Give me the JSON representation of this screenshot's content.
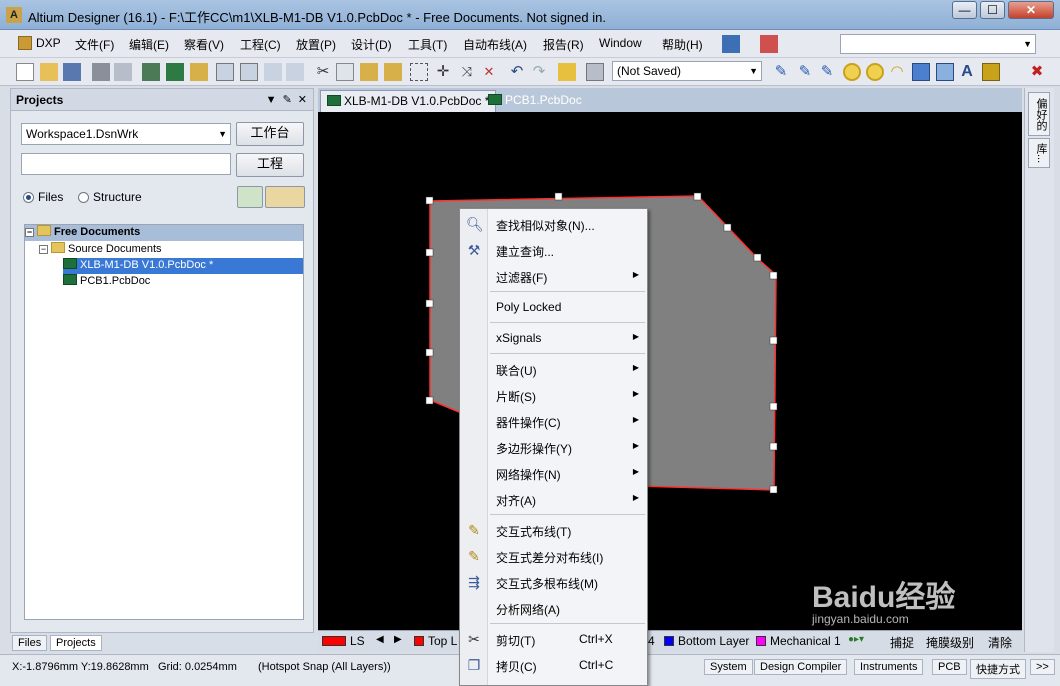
{
  "window": {
    "title": "Altium Designer (16.1) - F:\\工作CC\\m1\\XLB-M1-DB V1.0.PcbDoc * - Free Documents. Not signed in.",
    "minimize": "—",
    "maximize": "☐",
    "close": "✕"
  },
  "menubar": {
    "dxp": "DXP",
    "items": [
      "文件(F)",
      "编辑(E)",
      "察看(V)",
      "工程(C)",
      "放置(P)",
      "设计(D)",
      "工具(T)",
      "自动布线(A)",
      "报告(R)",
      "Window",
      "帮助(H)"
    ]
  },
  "toolbar": {
    "save_state": "(Not Saved)"
  },
  "projects_panel": {
    "title": "Projects",
    "workspace_select": "Workspace1.DsnWrk",
    "workspace_button": "工作台",
    "project_input": "",
    "project_button": "工程",
    "radio_files": "Files",
    "radio_structure": "Structure",
    "tree": {
      "root": "Free Documents",
      "folder": "Source Documents",
      "files": [
        "XLB-M1-DB V1.0.PcbDoc *",
        "PCB1.PcbDoc"
      ]
    },
    "tabs": [
      "Files",
      "Projects"
    ]
  },
  "doc_tabs": [
    "XLB-M1-DB V1.0.PcbDoc *",
    "PCB1.PcbDoc"
  ],
  "layer_bar": {
    "ls": "LS",
    "layers": [
      {
        "name": "Top L",
        "color": "#ff0000"
      },
      {
        "name": "4",
        "color": ""
      },
      {
        "name": "Bottom Layer",
        "color": "#0000ff"
      },
      {
        "name": "Mechanical 1",
        "color": "#ff00ff"
      }
    ],
    "actions": [
      "捕捉",
      "掩膜级别",
      "清除"
    ]
  },
  "right_strip": [
    "偏好的",
    "库..."
  ],
  "context_menu": {
    "items": [
      {
        "label": "查找相似对象(N)...",
        "icon": "search-icon"
      },
      {
        "label": "建立查询...",
        "icon": "hammer-icon"
      },
      {
        "label": "过滤器(F)",
        "submenu": true
      },
      {
        "label": "Poly Locked"
      },
      {
        "label": "xSignals",
        "submenu": true
      },
      {
        "label": "联合(U)",
        "submenu": true
      },
      {
        "label": "片断(S)",
        "submenu": true
      },
      {
        "label": "器件操作(C)",
        "submenu": true
      },
      {
        "label": "多边形操作(Y)",
        "submenu": true
      },
      {
        "label": "网络操作(N)",
        "submenu": true
      },
      {
        "label": "对齐(A)",
        "submenu": true
      },
      {
        "label": "交互式布线(T)",
        "icon": "route-icon"
      },
      {
        "label": "交互式差分对布线(I)",
        "icon": "diff-route-icon"
      },
      {
        "label": "交互式多根布线(M)",
        "icon": "multi-route-icon"
      },
      {
        "label": "分析网络(A)"
      },
      {
        "label": "剪切(T)",
        "shortcut": "Ctrl+X",
        "icon": "scissors-icon"
      },
      {
        "label": "拷贝(C)",
        "shortcut": "Ctrl+C",
        "icon": "copy-icon"
      }
    ]
  },
  "statusbar": {
    "coords": "X:-1.8796mm Y:19.8628mm",
    "grid": "Grid: 0.0254mm",
    "snap": "(Hotspot Snap (All Layers))",
    "buttons": [
      "System",
      "Design Compiler",
      "Instruments",
      "PCB",
      "快捷方式",
      ">>"
    ]
  },
  "watermark": {
    "brand": "Baidu经验",
    "url": "jingyan.baidu.com"
  },
  "colors": {
    "canvas": "#000000",
    "polygon": "#808080",
    "polygon_outline": "#ff3030",
    "arrow": "#e02020"
  }
}
